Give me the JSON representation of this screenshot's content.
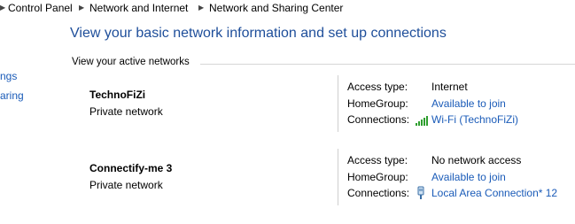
{
  "breadcrumb": {
    "items": [
      "Control Panel",
      "Network and Internet",
      "Network and Sharing Center"
    ]
  },
  "sidebar": {
    "link1": "ngs",
    "link2": "aring"
  },
  "page": {
    "title": "View your basic network information and set up connections",
    "section_heading": "View your active networks"
  },
  "labels": {
    "access_type": "Access type:",
    "homegroup": "HomeGroup:",
    "connections": "Connections:"
  },
  "networks": [
    {
      "name": "TechnoFiZi",
      "category": "Private network",
      "access_type": "Internet",
      "homegroup": "Available to join",
      "connection": "Wi-Fi (TechnoFiZi)",
      "connection_icon": "wifi-signal-icon"
    },
    {
      "name": "Connectify-me  3",
      "category": "Private network",
      "access_type": "No network access",
      "homegroup": "Available to join",
      "connection": "Local Area Connection* 12",
      "connection_icon": "ethernet-adapter-icon"
    }
  ],
  "colors": {
    "link": "#1a5bb8",
    "title": "#1e4e9a",
    "wifi_bars": "#2e9e2e"
  }
}
